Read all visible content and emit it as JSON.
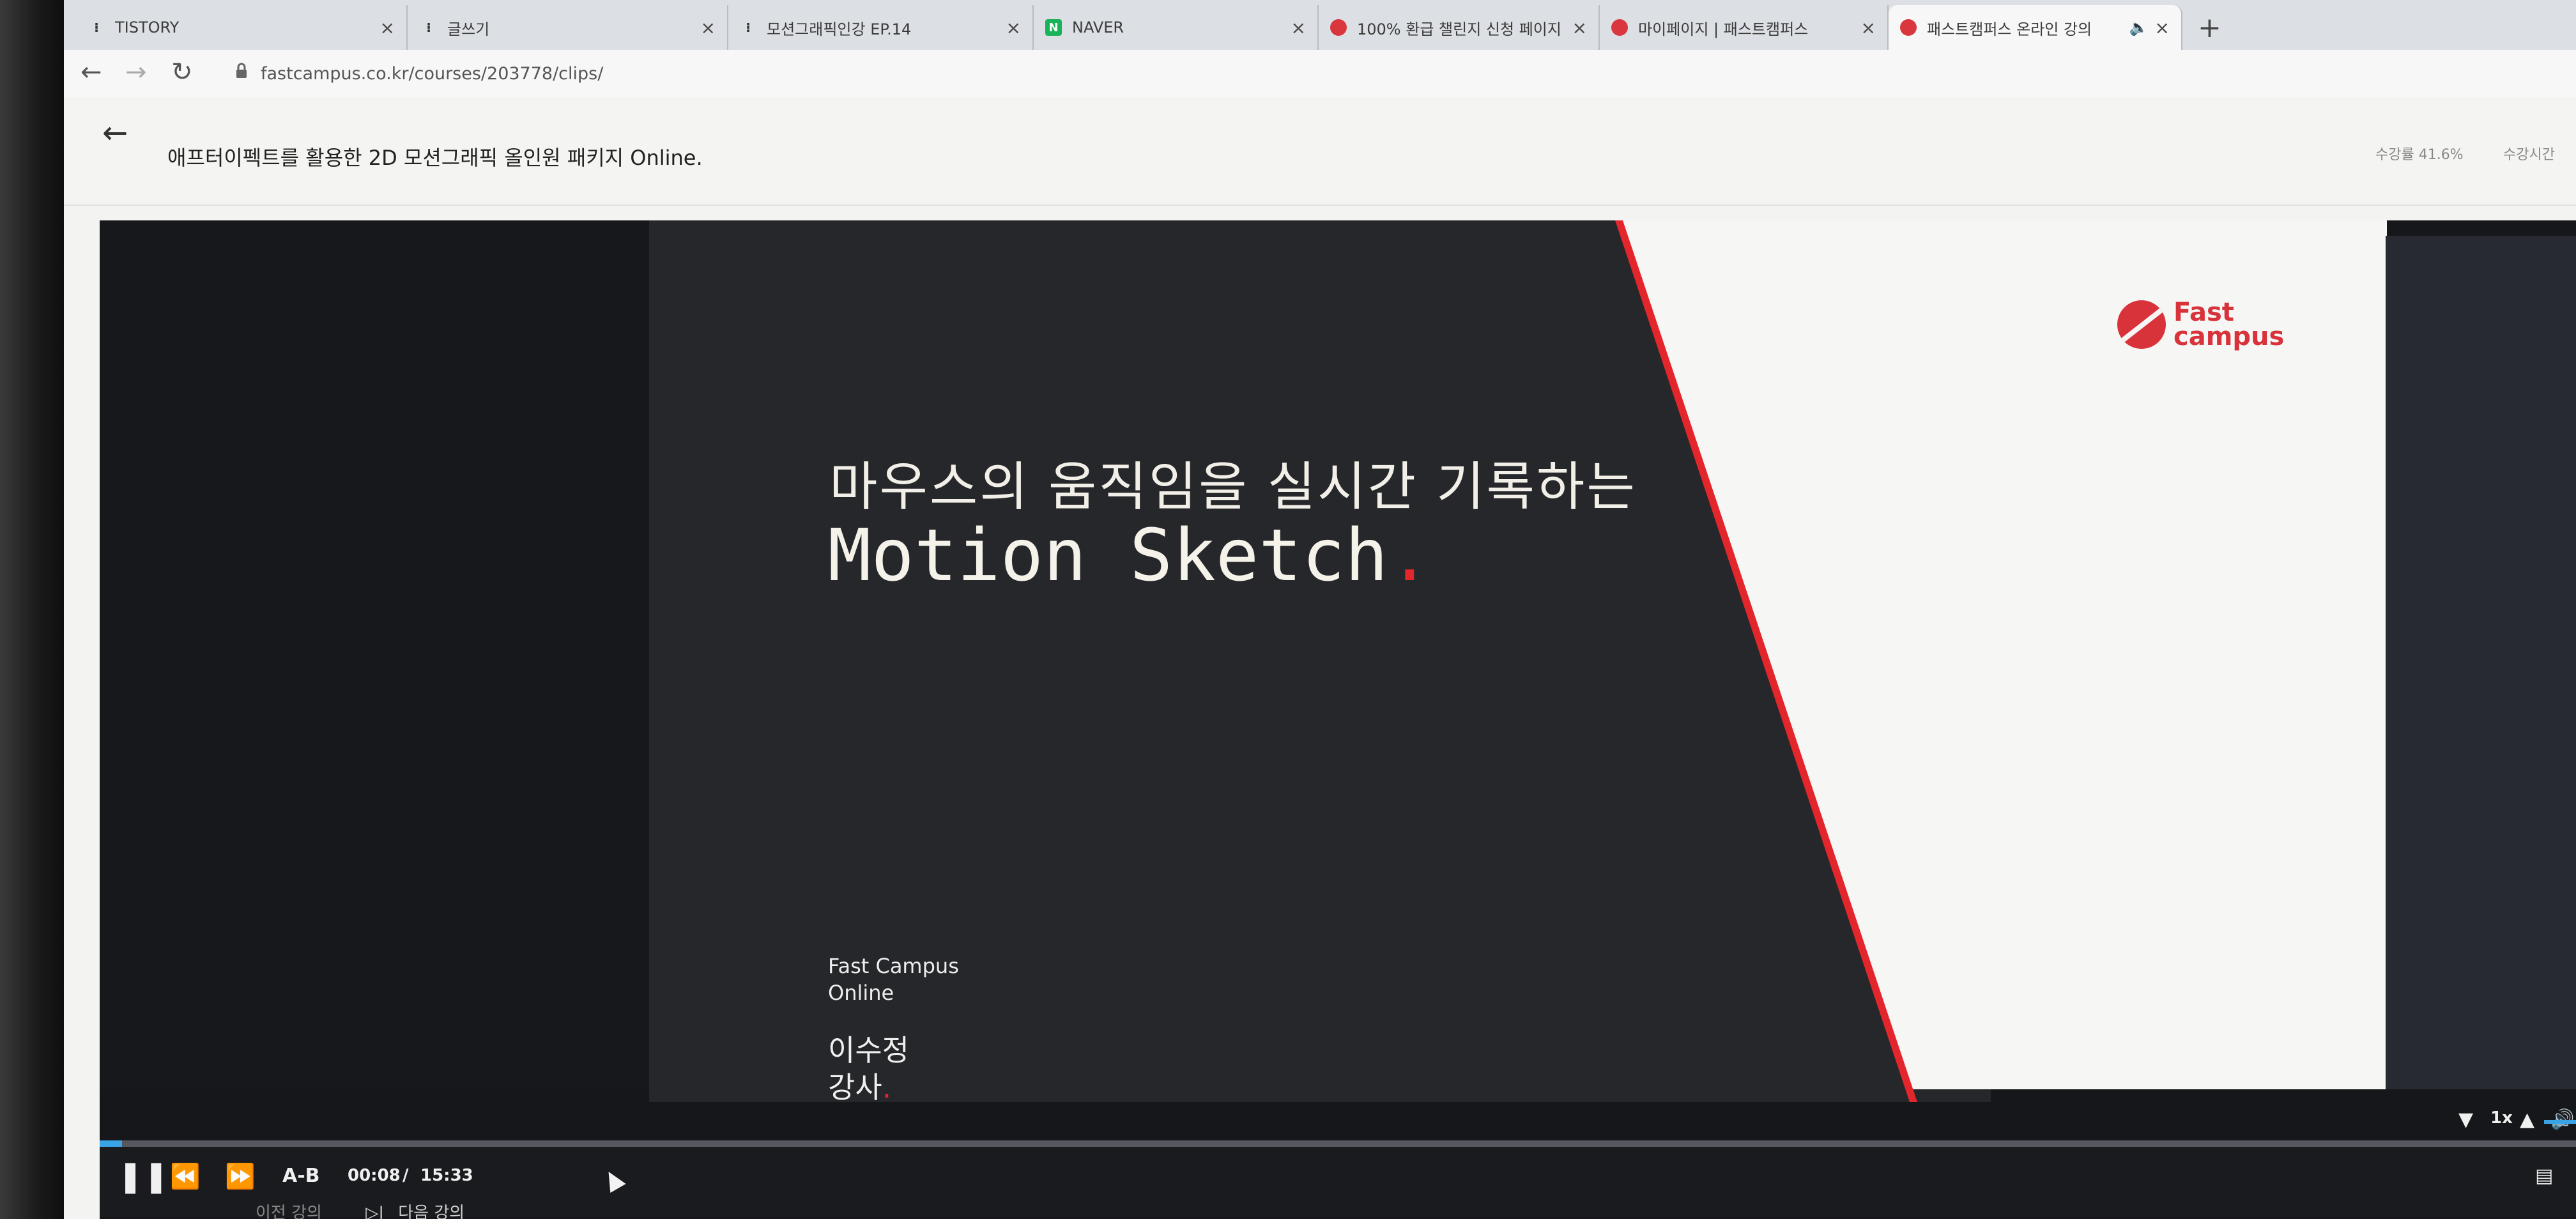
{
  "browser": {
    "tabs": [
      {
        "title": "TISTORY",
        "favicon": "tistory-icon"
      },
      {
        "title": "글쓰기",
        "favicon": "tistory-icon"
      },
      {
        "title": "모션그래픽인강 EP.14",
        "favicon": "tistory-icon"
      },
      {
        "title": "NAVER",
        "favicon": "naver-icon"
      },
      {
        "title": "100% 환급 챌린지 신청 페이지",
        "favicon": "fastcampus-icon"
      },
      {
        "title": "마이페이지 | 패스트캠퍼스",
        "favicon": "fastcampus-icon"
      },
      {
        "title": "패스트캠퍼스 온라인 강의",
        "favicon": "fastcampus-icon",
        "active": true,
        "audio": true
      }
    ],
    "new_tab_label": "+",
    "url": "fastcampus.co.kr/courses/203778/clips/"
  },
  "header": {
    "course_title": "애프터이펙트를 활용한 2D 모션그래픽 올인원 패키지 Online.",
    "progress_label": "수강률 41.6%",
    "course_time_label": "수강시간"
  },
  "slide": {
    "logo_text_line1": "Fast",
    "logo_text_line2": "campus",
    "headline_ko": "마우스의 움직임을 실시간 기록하는",
    "headline_en": "Motion Sketch",
    "headline_en_dot": ".",
    "brand_line1": "Fast Campus",
    "brand_line2": "Online",
    "instructor_name": "이수정",
    "instructor_title": "강사",
    "instructor_dot": "."
  },
  "player": {
    "ab_label": "A-B",
    "current_time": "00:08",
    "time_separator": "/",
    "duration": "15:33",
    "speed_label": "1x",
    "progress_fraction": 0.009,
    "accent_color": "#3aa3e6"
  },
  "footer": {
    "prev_label": "이전 강의",
    "next_label": "다음 강의"
  },
  "colors": {
    "brand_red": "#e2262c",
    "slide_dark": "#26272a"
  }
}
